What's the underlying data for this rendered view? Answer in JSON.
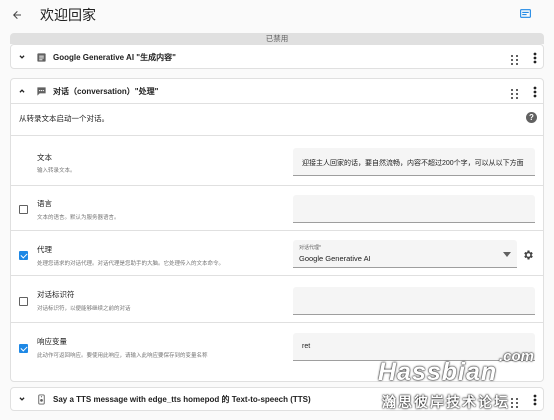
{
  "header": {
    "title": "欢迎回家"
  },
  "disabled_label": "已禁用",
  "action1": {
    "title": "Google Generative AI \"生成内容\""
  },
  "action2": {
    "title": "对话（conversation）\"处理\"",
    "description": "从转录文本启动一个对话。",
    "help": "?",
    "fields": {
      "text": {
        "label": "文本",
        "desc": "输入转录文本。",
        "value": "迎接主人回家的话，要自然流畅，内容不超过200个字，可以从以下方面"
      },
      "language": {
        "label": "语言",
        "desc": "文本的语言。默认为服务器语言。",
        "value": ""
      },
      "agent": {
        "label": "代理",
        "desc": "处理您请求的对话代理。对话代理是您助手的大脑。它处理传入的文本命令。",
        "select_label": "对话代理*",
        "select_value": "Google Generative AI"
      },
      "conversation_id": {
        "label": "对话标识符",
        "desc": "对话标识符，以便能够继续之前的对话",
        "value": ""
      },
      "response_variable": {
        "label": "响应变量",
        "desc": "此动作可返回响应。要使用此响应，请输入此响应要保存到的变量名称",
        "value": "ret"
      }
    }
  },
  "action3": {
    "title": "Say a TTS message with edge_tts homepod 的 Text-to-speech (TTS)"
  },
  "watermark": {
    "com": ".com",
    "brand": "Hassbian",
    "sub": "瀚思彼岸技术论坛"
  },
  "colors": {
    "accent": "#1e88e5",
    "divider": "#e0e0e0",
    "input_bg": "#f5f5f5"
  }
}
